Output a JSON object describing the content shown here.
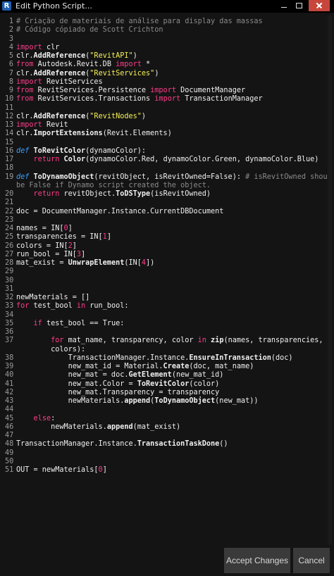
{
  "window": {
    "app_icon_letter": "R",
    "title": "Edit Python Script..."
  },
  "editor": {
    "lines": [
      {
        "n": "1",
        "tokens": [
          {
            "t": "# Criação de materiais de análise para display das massas",
            "c": "comment"
          }
        ]
      },
      {
        "n": "2",
        "tokens": [
          {
            "t": "# Código cópiado de Scott Crichton",
            "c": "comment"
          }
        ]
      },
      {
        "n": "3",
        "tokens": []
      },
      {
        "n": "4",
        "tokens": [
          {
            "t": "import",
            "c": "kw"
          },
          {
            "t": " clr",
            "c": ""
          }
        ]
      },
      {
        "n": "5",
        "tokens": [
          {
            "t": "clr.",
            "c": ""
          },
          {
            "t": "AddReference",
            "c": "b"
          },
          {
            "t": "(",
            "c": ""
          },
          {
            "t": "\"RevitAPI\"",
            "c": "str"
          },
          {
            "t": ")",
            "c": ""
          }
        ]
      },
      {
        "n": "6",
        "tokens": [
          {
            "t": "from",
            "c": "kw"
          },
          {
            "t": " Autodesk.Revit.DB ",
            "c": ""
          },
          {
            "t": "import",
            "c": "kw"
          },
          {
            "t": " *",
            "c": ""
          }
        ]
      },
      {
        "n": "7",
        "tokens": [
          {
            "t": "clr.",
            "c": ""
          },
          {
            "t": "AddReference",
            "c": "b"
          },
          {
            "t": "(",
            "c": ""
          },
          {
            "t": "\"RevitServices\"",
            "c": "str"
          },
          {
            "t": ")",
            "c": ""
          }
        ]
      },
      {
        "n": "8",
        "tokens": [
          {
            "t": "import",
            "c": "kw"
          },
          {
            "t": " RevitServices",
            "c": ""
          }
        ]
      },
      {
        "n": "9",
        "tokens": [
          {
            "t": "from",
            "c": "kw"
          },
          {
            "t": " RevitServices.Persistence ",
            "c": ""
          },
          {
            "t": "import",
            "c": "kw"
          },
          {
            "t": " DocumentManager",
            "c": ""
          }
        ]
      },
      {
        "n": "10",
        "tokens": [
          {
            "t": "from",
            "c": "kw"
          },
          {
            "t": " RevitServices.Transactions ",
            "c": ""
          },
          {
            "t": "import",
            "c": "kw"
          },
          {
            "t": " TransactionManager",
            "c": ""
          }
        ]
      },
      {
        "n": "11",
        "tokens": []
      },
      {
        "n": "12",
        "tokens": [
          {
            "t": "clr.",
            "c": ""
          },
          {
            "t": "AddReference",
            "c": "b"
          },
          {
            "t": "(",
            "c": ""
          },
          {
            "t": "\"RevitNodes\"",
            "c": "str"
          },
          {
            "t": ")",
            "c": ""
          }
        ]
      },
      {
        "n": "13",
        "tokens": [
          {
            "t": "import",
            "c": "kw"
          },
          {
            "t": " Revit",
            "c": ""
          }
        ]
      },
      {
        "n": "14",
        "tokens": [
          {
            "t": "clr.",
            "c": ""
          },
          {
            "t": "ImportExtensions",
            "c": "b"
          },
          {
            "t": "(Revit.Elements)",
            "c": ""
          }
        ]
      },
      {
        "n": "15",
        "tokens": []
      },
      {
        "n": "16",
        "tokens": [
          {
            "t": "def",
            "c": "def"
          },
          {
            "t": " ",
            "c": ""
          },
          {
            "t": "ToRevitColor",
            "c": "b"
          },
          {
            "t": "(dynamoColor):",
            "c": ""
          }
        ]
      },
      {
        "n": "17",
        "tokens": [
          {
            "t": "    ",
            "c": ""
          },
          {
            "t": "return",
            "c": "kw"
          },
          {
            "t": " ",
            "c": ""
          },
          {
            "t": "Color",
            "c": "b"
          },
          {
            "t": "(dynamoColor.Red, dynamoColor.Green, dynamoColor.Blue)",
            "c": ""
          }
        ]
      },
      {
        "n": "18",
        "tokens": []
      },
      {
        "n": "19",
        "tokens": [
          {
            "t": "def",
            "c": "def"
          },
          {
            "t": " ",
            "c": ""
          },
          {
            "t": "ToDynamoObject",
            "c": "b"
          },
          {
            "t": "(revitObject, isRevitOwned=False): ",
            "c": ""
          },
          {
            "t": "# isRevitOwned should",
            "c": "comment"
          }
        ]
      },
      {
        "n": "",
        "tokens": [
          {
            "t": "be False if Dynamo script created the object.",
            "c": "comment"
          }
        ]
      },
      {
        "n": "20",
        "tokens": [
          {
            "t": "    ",
            "c": ""
          },
          {
            "t": "return",
            "c": "kw"
          },
          {
            "t": " revitObject.",
            "c": ""
          },
          {
            "t": "ToDSType",
            "c": "b"
          },
          {
            "t": "(isRevitOwned)",
            "c": ""
          }
        ]
      },
      {
        "n": "21",
        "tokens": []
      },
      {
        "n": "22",
        "tokens": [
          {
            "t": "doc = DocumentManager.Instance.CurrentDBDocument",
            "c": ""
          }
        ]
      },
      {
        "n": "23",
        "tokens": []
      },
      {
        "n": "24",
        "tokens": [
          {
            "t": "names = IN[",
            "c": ""
          },
          {
            "t": "0",
            "c": "kw"
          },
          {
            "t": "]",
            "c": ""
          }
        ]
      },
      {
        "n": "25",
        "tokens": [
          {
            "t": "transparencies = IN[",
            "c": ""
          },
          {
            "t": "1",
            "c": "kw"
          },
          {
            "t": "]",
            "c": ""
          }
        ]
      },
      {
        "n": "26",
        "tokens": [
          {
            "t": "colors = IN[",
            "c": ""
          },
          {
            "t": "2",
            "c": "kw"
          },
          {
            "t": "]",
            "c": ""
          }
        ]
      },
      {
        "n": "27",
        "tokens": [
          {
            "t": "run_bool = IN[",
            "c": ""
          },
          {
            "t": "3",
            "c": "kw"
          },
          {
            "t": "]",
            "c": ""
          }
        ]
      },
      {
        "n": "28",
        "tokens": [
          {
            "t": "mat_exist = ",
            "c": ""
          },
          {
            "t": "UnwrapElement",
            "c": "b"
          },
          {
            "t": "(IN[",
            "c": ""
          },
          {
            "t": "4",
            "c": "kw"
          },
          {
            "t": "])",
            "c": ""
          }
        ]
      },
      {
        "n": "29",
        "tokens": []
      },
      {
        "n": "30",
        "tokens": []
      },
      {
        "n": "31",
        "tokens": []
      },
      {
        "n": "32",
        "tokens": [
          {
            "t": "newMaterials = []",
            "c": ""
          }
        ]
      },
      {
        "n": "33",
        "tokens": [
          {
            "t": "for",
            "c": "kw"
          },
          {
            "t": " test_bool ",
            "c": ""
          },
          {
            "t": "in",
            "c": "kw"
          },
          {
            "t": " run_bool:",
            "c": ""
          }
        ]
      },
      {
        "n": "34",
        "tokens": []
      },
      {
        "n": "35",
        "tokens": [
          {
            "t": "    ",
            "c": ""
          },
          {
            "t": "if",
            "c": "kw"
          },
          {
            "t": " test_bool == True:",
            "c": ""
          }
        ]
      },
      {
        "n": "36",
        "tokens": []
      },
      {
        "n": "37",
        "tokens": [
          {
            "t": "        ",
            "c": ""
          },
          {
            "t": "for",
            "c": "kw"
          },
          {
            "t": " mat_name, transparency, color ",
            "c": ""
          },
          {
            "t": "in",
            "c": "kw"
          },
          {
            "t": " ",
            "c": ""
          },
          {
            "t": "zip",
            "c": "b"
          },
          {
            "t": "(names, transparencies,",
            "c": ""
          }
        ]
      },
      {
        "n": "",
        "tokens": [
          {
            "t": "        colors):",
            "c": ""
          }
        ]
      },
      {
        "n": "38",
        "tokens": [
          {
            "t": "            TransactionManager.Instance.",
            "c": ""
          },
          {
            "t": "EnsureInTransaction",
            "c": "b"
          },
          {
            "t": "(doc)",
            "c": ""
          }
        ]
      },
      {
        "n": "39",
        "tokens": [
          {
            "t": "            new_mat_id = Material.",
            "c": ""
          },
          {
            "t": "Create",
            "c": "b"
          },
          {
            "t": "(doc, mat_name)",
            "c": ""
          }
        ]
      },
      {
        "n": "40",
        "tokens": [
          {
            "t": "            new_mat = doc.",
            "c": ""
          },
          {
            "t": "GetElement",
            "c": "b"
          },
          {
            "t": "(new_mat_id)",
            "c": ""
          }
        ]
      },
      {
        "n": "41",
        "tokens": [
          {
            "t": "            new_mat.Color = ",
            "c": ""
          },
          {
            "t": "ToRevitColor",
            "c": "b"
          },
          {
            "t": "(color)",
            "c": ""
          }
        ]
      },
      {
        "n": "42",
        "tokens": [
          {
            "t": "            new_mat.Transparency = transparency",
            "c": ""
          }
        ]
      },
      {
        "n": "43",
        "tokens": [
          {
            "t": "            newMaterials.",
            "c": ""
          },
          {
            "t": "append",
            "c": "b"
          },
          {
            "t": "(",
            "c": ""
          },
          {
            "t": "ToDynamoObject",
            "c": "b"
          },
          {
            "t": "(new_mat))",
            "c": ""
          }
        ]
      },
      {
        "n": "44",
        "tokens": []
      },
      {
        "n": "45",
        "tokens": [
          {
            "t": "    ",
            "c": ""
          },
          {
            "t": "else",
            "c": "kw"
          },
          {
            "t": ":",
            "c": ""
          }
        ]
      },
      {
        "n": "46",
        "tokens": [
          {
            "t": "        newMaterials.",
            "c": ""
          },
          {
            "t": "append",
            "c": "b"
          },
          {
            "t": "(mat_exist)",
            "c": ""
          }
        ]
      },
      {
        "n": "47",
        "tokens": []
      },
      {
        "n": "48",
        "tokens": [
          {
            "t": "TransactionManager.Instance.",
            "c": ""
          },
          {
            "t": "TransactionTaskDone",
            "c": "b"
          },
          {
            "t": "()",
            "c": ""
          }
        ]
      },
      {
        "n": "49",
        "tokens": []
      },
      {
        "n": "50",
        "tokens": []
      },
      {
        "n": "51",
        "tokens": [
          {
            "t": "OUT = newMaterials[",
            "c": ""
          },
          {
            "t": "0",
            "c": "kw"
          },
          {
            "t": "]",
            "c": ""
          }
        ]
      }
    ]
  },
  "footer": {
    "accept_label": "Accept Changes",
    "cancel_label": "Cancel"
  },
  "colors": {
    "comment": "#8a8a8a",
    "keyword": "#ff3b8a",
    "string": "#f5f05a",
    "def": "#3aa0ff",
    "text": "#f0f0f0",
    "background": "#141414",
    "close_button": "#c7463c"
  },
  "icons": [
    "revit-app-icon",
    "minimize-icon",
    "maximize-icon",
    "close-icon"
  ]
}
